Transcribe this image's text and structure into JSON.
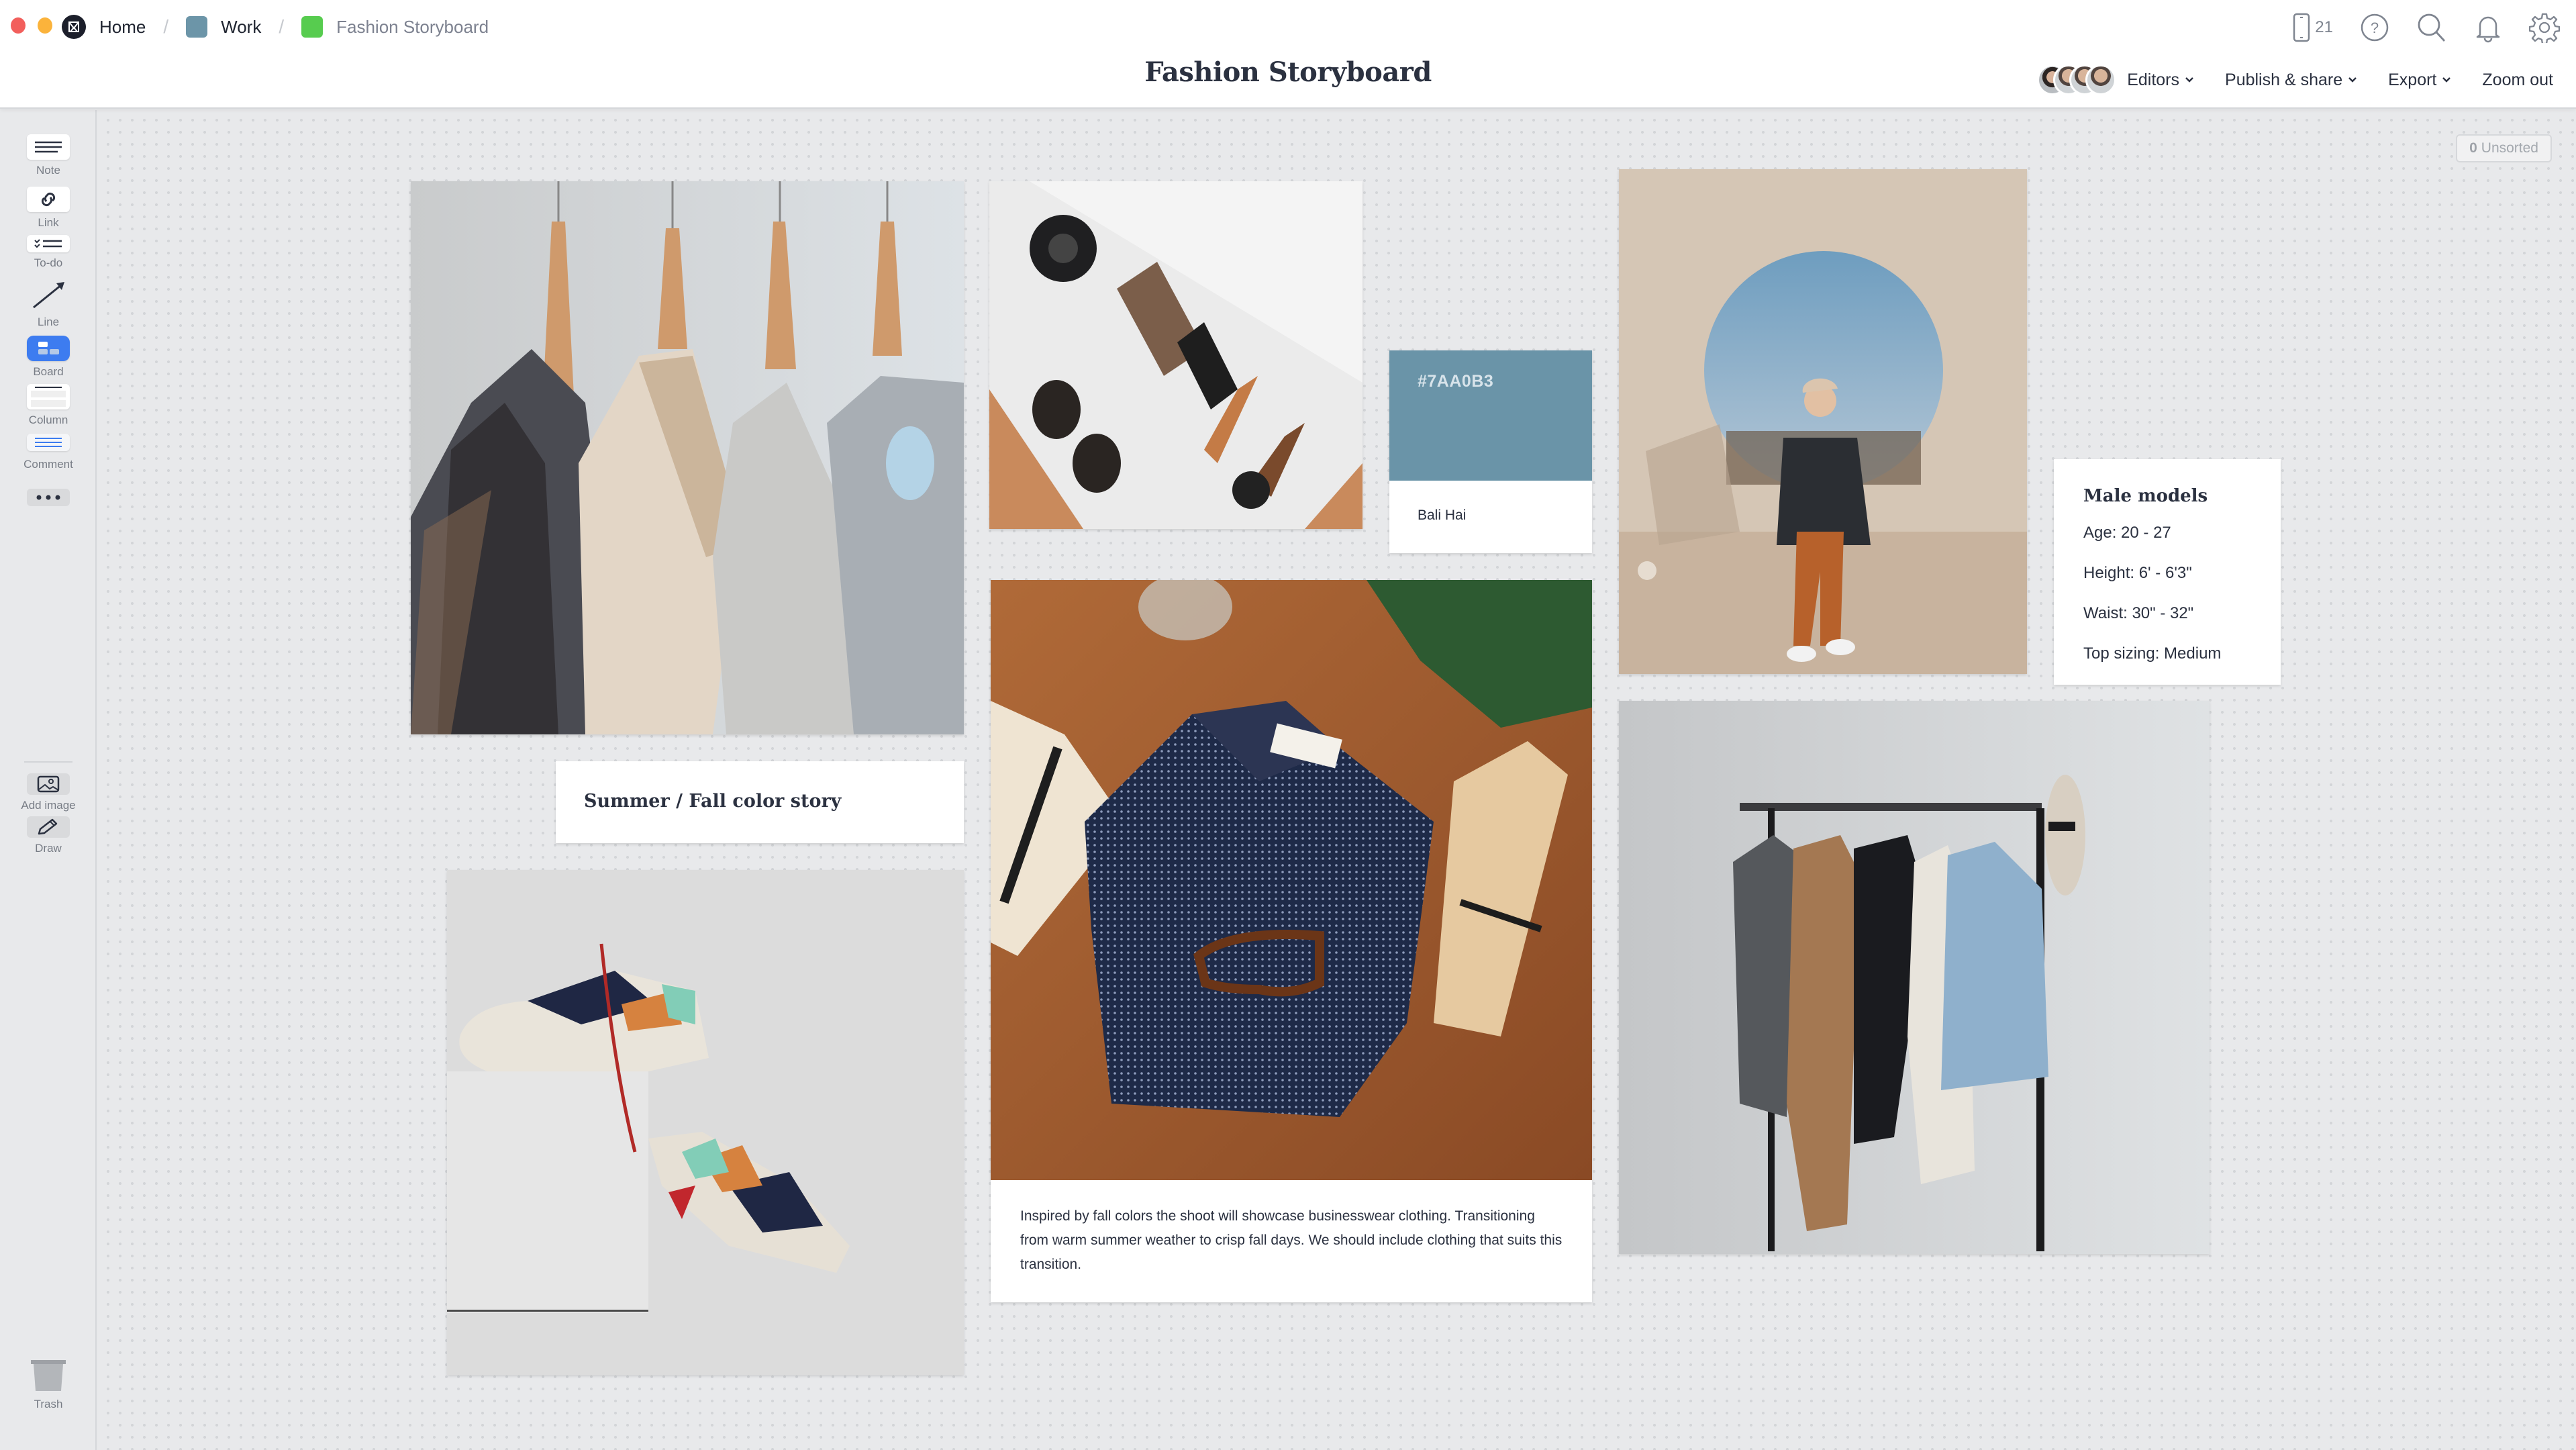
{
  "window": {
    "traffic_lights": {
      "close": "#f25f5c",
      "minimize": "#fbb33b",
      "maximize": "#57c84d"
    }
  },
  "breadcrumb": [
    {
      "label": "Home",
      "icon": "milanote-logo-icon"
    },
    {
      "label": "Work",
      "icon": "board-icon",
      "color": "#6c95a8"
    },
    {
      "label": "Fashion Storyboard",
      "icon": "board-icon",
      "color": "#57cc4f"
    }
  ],
  "header": {
    "title": "Fashion Storyboard",
    "device_count": "21",
    "icons": [
      "mobile-device-icon",
      "help-icon",
      "search-icon",
      "notification-bell-icon",
      "settings-gear-icon"
    ],
    "actions": {
      "editors": "Editors",
      "publish_share": "Publish & share",
      "export": "Export",
      "zoom_out": "Zoom out"
    },
    "editor_avatars": 4
  },
  "sidebar": {
    "tools": [
      {
        "label": "Note",
        "icon": "note-icon"
      },
      {
        "label": "Link",
        "icon": "link-icon"
      },
      {
        "label": "To-do",
        "icon": "todo-icon"
      },
      {
        "label": "Line",
        "icon": "line-arrow-icon"
      },
      {
        "label": "Board",
        "icon": "board-icon"
      },
      {
        "label": "Column",
        "icon": "column-icon"
      },
      {
        "label": "Comment",
        "icon": "comment-icon"
      },
      {
        "label": "",
        "icon": "more-icon"
      },
      {
        "label": "Add image",
        "icon": "add-image-icon"
      },
      {
        "label": "Draw",
        "icon": "pencil-icon"
      },
      {
        "label": "Trash",
        "icon": "trash-icon"
      }
    ]
  },
  "canvas": {
    "unsorted": {
      "count": "0",
      "label": "Unsorted"
    },
    "images": [
      {
        "name": "clothes-on-hangers",
        "alt": "Shirts and jackets on wooden hangers"
      },
      {
        "name": "accessories-flatlay",
        "alt": "Watch, sunglasses, lens and wallet in a drawer"
      },
      {
        "name": "model-sitting",
        "alt": "Male model sitting in front of circular window"
      },
      {
        "name": "folded-shirt",
        "alt": "Folded navy dotted shirt with glasses and tie"
      },
      {
        "name": "sneakers",
        "alt": "Two colorful sneakers on white block"
      },
      {
        "name": "clothing-rack",
        "alt": "Clothing rack with jackets and hat"
      }
    ],
    "color_swatch": {
      "hex": "#7AA0B3",
      "name": "Bali Hai",
      "display_color": "#6a94a8"
    },
    "heading_card": "Summer / Fall color story",
    "male_models": {
      "title": "Male models",
      "lines": [
        "Age: 20 - 27",
        "Height: 6' - 6'3\"",
        "Waist: 30\" - 32\"",
        "Top sizing: Medium"
      ]
    },
    "description": "Inspired by fall colors the shoot will showcase businesswear clothing. Transitioning from warm summer weather to crisp fall days. We should include clothing that suits this transition."
  }
}
